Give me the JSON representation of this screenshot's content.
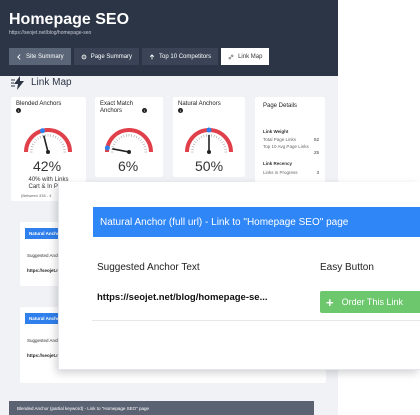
{
  "app": {
    "title": "Homepage SEO",
    "url": "https://seojet.net/blog/homepage-seo"
  },
  "tabs": [
    {
      "label": "Site Summary",
      "icon": "arrow-left-icon"
    },
    {
      "label": "Page Summary",
      "icon": "gear-icon"
    },
    {
      "label": "Top 10 Competitors",
      "icon": "arrow-up-icon"
    },
    {
      "label": "Link Map",
      "icon": "link-icon"
    }
  ],
  "section": {
    "title": "Link Map",
    "icon": "lightning-icon"
  },
  "cards": [
    {
      "title": "Blended Anchors",
      "value": "42%",
      "fraction": 0.42,
      "footer1": "40% with Links",
      "footer2": "Cart & In Progr",
      "footer3": "(Between 335 - 4"
    },
    {
      "title": "Exact Match Anchors",
      "value": "6%",
      "fraction": 0.06
    },
    {
      "title": "Natural Anchors",
      "value": "50%",
      "fraction": 0.5
    }
  ],
  "details": {
    "title": "Page Details",
    "link_weight_label": "Link Weight",
    "total_page_links_label": "Total Page Links",
    "total_page_links_value": "52",
    "top10_avg_label": "Top 10 Avg Page Links",
    "top10_avg_value": "25",
    "link_recency_label": "Link Recency",
    "links_in_progress_label": "Links in Progress",
    "links_in_progress_value": "3"
  },
  "strips": [
    {
      "bar_label": "Natural Anchor",
      "suggested_label": "Suggested Anchor",
      "url": "https://seojet.n"
    },
    {
      "bar_label": "Natural Anchor",
      "suggested_label": "Suggested Anchor",
      "url": "https://seojet.n"
    }
  ],
  "bottom_bar": "Blended Anchor (partial keyword) - Link to \"Homepage SEO\" page",
  "modal": {
    "bar_title": "Natural Anchor (full url) - Link to \"Homepage SEO\" page",
    "col_suggested": "Suggested Anchor Text",
    "col_easy": "Easy Button",
    "anchor_url": "https://seojet.net/blog/homepage-se...",
    "order_button": "Order This Link"
  },
  "colors": {
    "header": "#2c3545",
    "accent_blue": "#2f86f6",
    "button_green": "#6cc76d",
    "gauge_red": "#e0404a",
    "gauge_blue": "#2f80ed"
  }
}
